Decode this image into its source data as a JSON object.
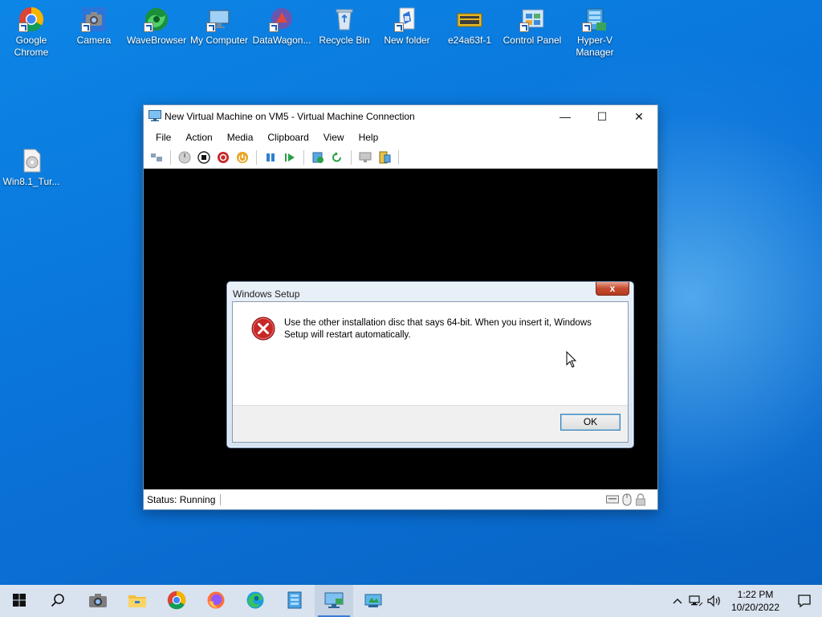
{
  "desktop": {
    "icons": [
      {
        "label": "Google Chrome",
        "icon": "chrome-icon"
      },
      {
        "label": "Camera",
        "icon": "camera-icon"
      },
      {
        "label": "WaveBrowser",
        "icon": "wavebrowser-icon"
      },
      {
        "label": "My Computer",
        "icon": "computer-icon"
      },
      {
        "label": "DataWagon...",
        "icon": "datawagon-icon"
      },
      {
        "label": "Recycle Bin",
        "icon": "recycle-bin-icon"
      },
      {
        "label": "New folder",
        "icon": "folder-icon"
      },
      {
        "label": "e24a63f-1",
        "icon": "image-file-icon"
      },
      {
        "label": "Control Panel",
        "icon": "control-panel-icon"
      },
      {
        "label": "Hyper-V Manager",
        "icon": "hyperv-manager-icon"
      },
      {
        "label": "Win8.1_Tur...",
        "icon": "iso-disc-icon"
      }
    ]
  },
  "vm_window": {
    "title": "New Virtual Machine on VM5 - Virtual Machine Connection",
    "controls": {
      "minimize": "—",
      "maximize": "☐",
      "close": "✕"
    },
    "menu": [
      "File",
      "Action",
      "Media",
      "Clipboard",
      "View",
      "Help"
    ],
    "status": "Status: Running"
  },
  "setup_dialog": {
    "title": "Windows Setup",
    "close_label": "x",
    "message": "Use the other installation disc that says 64-bit. When you insert it, Windows Setup will restart automatically.",
    "ok_label": "OK"
  },
  "taskbar": {
    "items": [
      "start-icon",
      "search-icon",
      "camera-icon",
      "file-explorer-icon",
      "chrome-icon",
      "firefox-icon",
      "edge-icon",
      "hyperv-manager-icon",
      "vm-connection-icon",
      "app-icon"
    ],
    "time": "1:22 PM",
    "date": "10/20/2022"
  },
  "colors": {
    "desktop": "#0a74da",
    "error_red": "#c62828",
    "accent": "#3a7bd5"
  }
}
